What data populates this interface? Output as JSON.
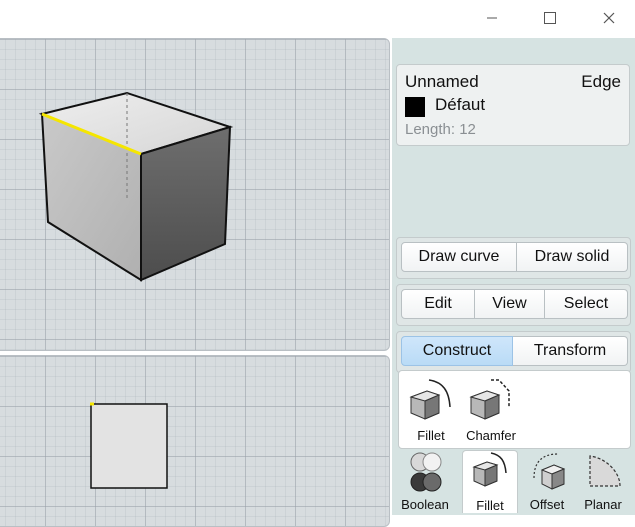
{
  "window": {
    "minimize_icon": "minimize-icon",
    "maximize_icon": "maximize-icon",
    "close_icon": "close-icon"
  },
  "properties": {
    "name": "Unnamed",
    "type": "Edge",
    "layer": "Défaut",
    "layer_color": "#000000",
    "length": "Length: 12"
  },
  "draw_group": {
    "draw_curve": "Draw curve",
    "draw_solid": "Draw solid"
  },
  "mode_group": {
    "edit": "Edit",
    "view": "View",
    "select": "Select"
  },
  "category_tabs": {
    "construct": "Construct",
    "transform": "Transform",
    "active": "Construct"
  },
  "construct_tools": [
    {
      "label": "Fillet",
      "icon": "fillet-icon"
    },
    {
      "label": "Chamfer",
      "icon": "chamfer-icon"
    }
  ],
  "bottom_tools": [
    {
      "label": "Boolean",
      "icon": "boolean-icon"
    },
    {
      "label": "Fillet",
      "icon": "fillet-icon",
      "selected": true
    },
    {
      "label": "Offset",
      "icon": "offset-icon"
    },
    {
      "label": "Planar",
      "icon": "planar-icon"
    }
  ],
  "colors": {
    "selection": "#f5e600",
    "panel_bg": "#d6e3e2",
    "active_tab": "#bcdcf7"
  }
}
